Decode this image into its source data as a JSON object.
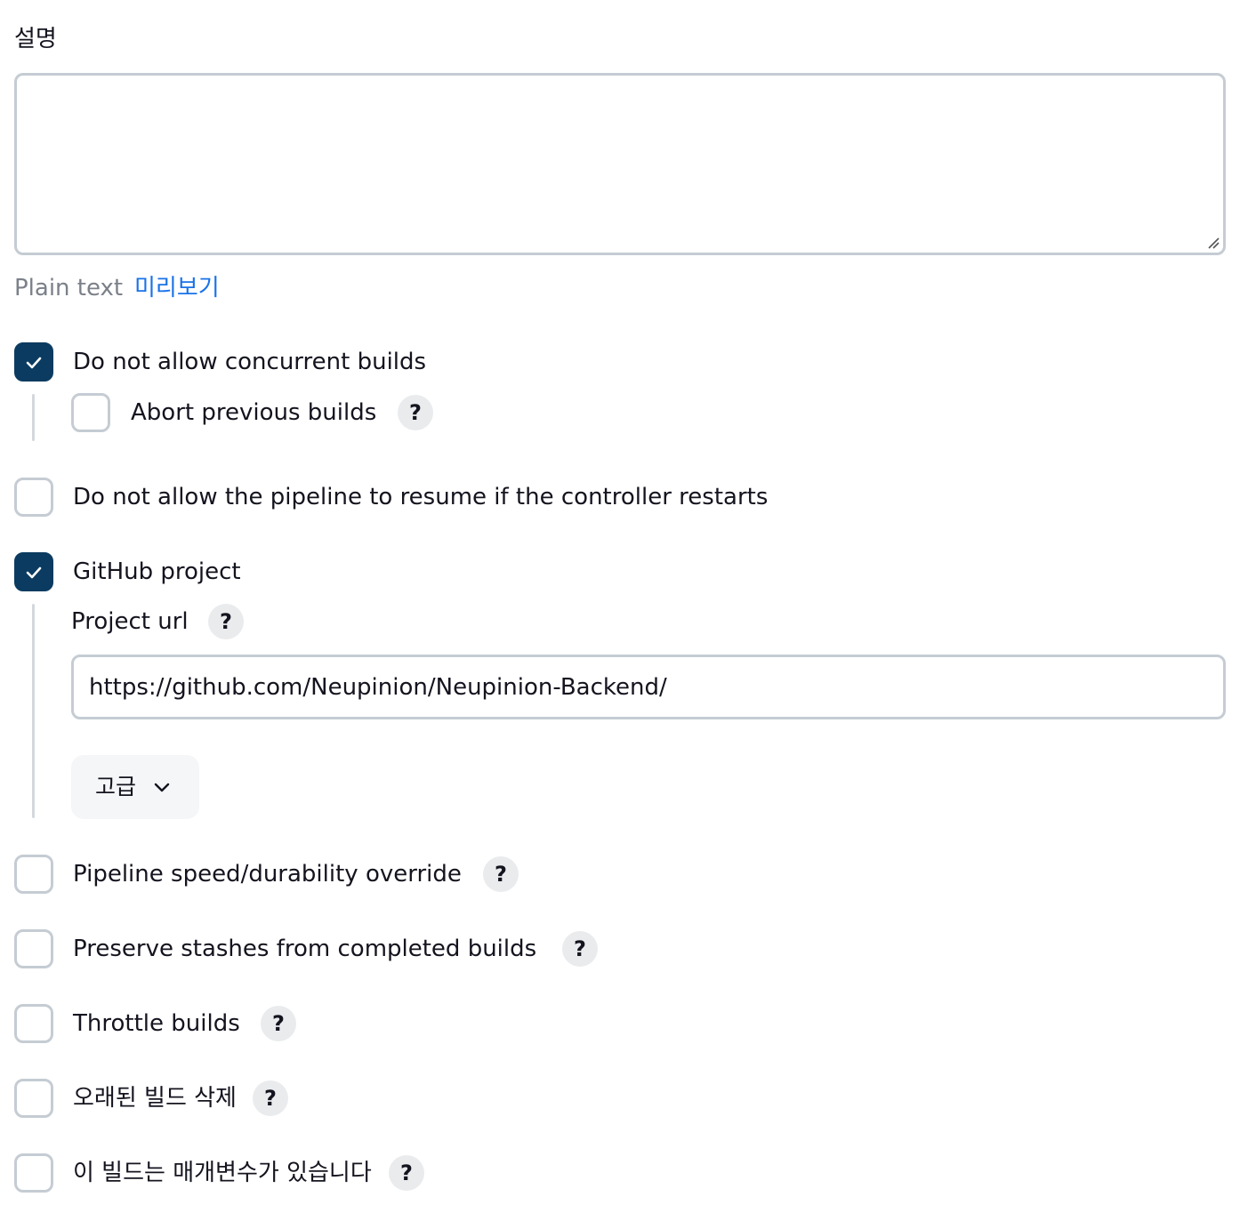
{
  "description": {
    "label": "설명",
    "value": "",
    "format_label": "Plain text",
    "preview_link": "미리보기"
  },
  "options": {
    "no_concurrent": {
      "label": "Do not allow concurrent builds",
      "checked": true
    },
    "abort_previous": {
      "label": "Abort previous builds",
      "checked": false
    },
    "no_resume": {
      "label": "Do not allow the pipeline to resume if the controller restarts",
      "checked": false
    },
    "github_project": {
      "label": "GitHub project",
      "checked": true
    },
    "durability_override": {
      "label": "Pipeline speed/durability override",
      "checked": false
    },
    "preserve_stashes": {
      "label": "Preserve stashes from completed builds",
      "checked": false
    },
    "throttle_builds": {
      "label": "Throttle builds",
      "checked": false
    },
    "discard_old_builds": {
      "label": "오래된 빌드 삭제",
      "checked": false
    },
    "parameterized": {
      "label": "이 빌드는 매개변수가 있습니다",
      "checked": false
    }
  },
  "github": {
    "project_url_label": "Project url",
    "project_url_value": "https://github.com/Neupinion/Neupinion-Backend/",
    "advanced_label": "고급"
  },
  "help_glyph": "?",
  "colors": {
    "checked_fill": "#0b3b60",
    "link": "#1a73e8",
    "border": "#c5ccd3",
    "muted_text": "#7b8089"
  }
}
